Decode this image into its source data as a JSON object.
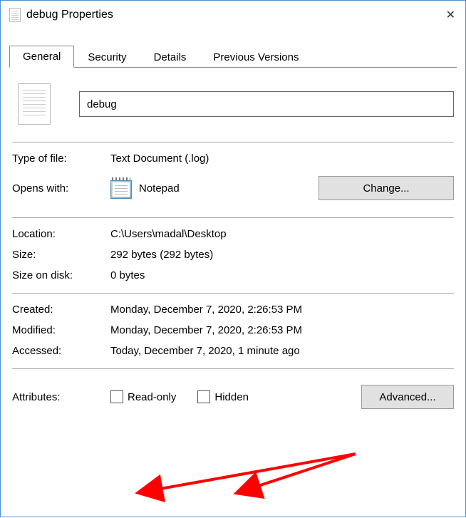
{
  "window": {
    "title": "debug Properties"
  },
  "tabs": {
    "general": "General",
    "security": "Security",
    "details": "Details",
    "previous": "Previous Versions"
  },
  "file": {
    "name": "debug"
  },
  "labels": {
    "typeOfFile": "Type of file:",
    "opensWith": "Opens with:",
    "location": "Location:",
    "size": "Size:",
    "sizeOnDisk": "Size on disk:",
    "created": "Created:",
    "modified": "Modified:",
    "accessed": "Accessed:",
    "attributes": "Attributes:"
  },
  "values": {
    "typeOfFile": "Text Document (.log)",
    "opensWith": "Notepad",
    "location": "C:\\Users\\madal\\Desktop",
    "size": "292 bytes (292 bytes)",
    "sizeOnDisk": "0 bytes",
    "created": "Monday, December 7, 2020, 2:26:53 PM",
    "modified": "Monday, December 7, 2020, 2:26:53 PM",
    "accessed": "Today, December 7, 2020, 1 minute ago"
  },
  "attributes": {
    "readOnly": "Read-only",
    "hidden": "Hidden"
  },
  "buttons": {
    "change": "Change...",
    "advanced": "Advanced..."
  }
}
